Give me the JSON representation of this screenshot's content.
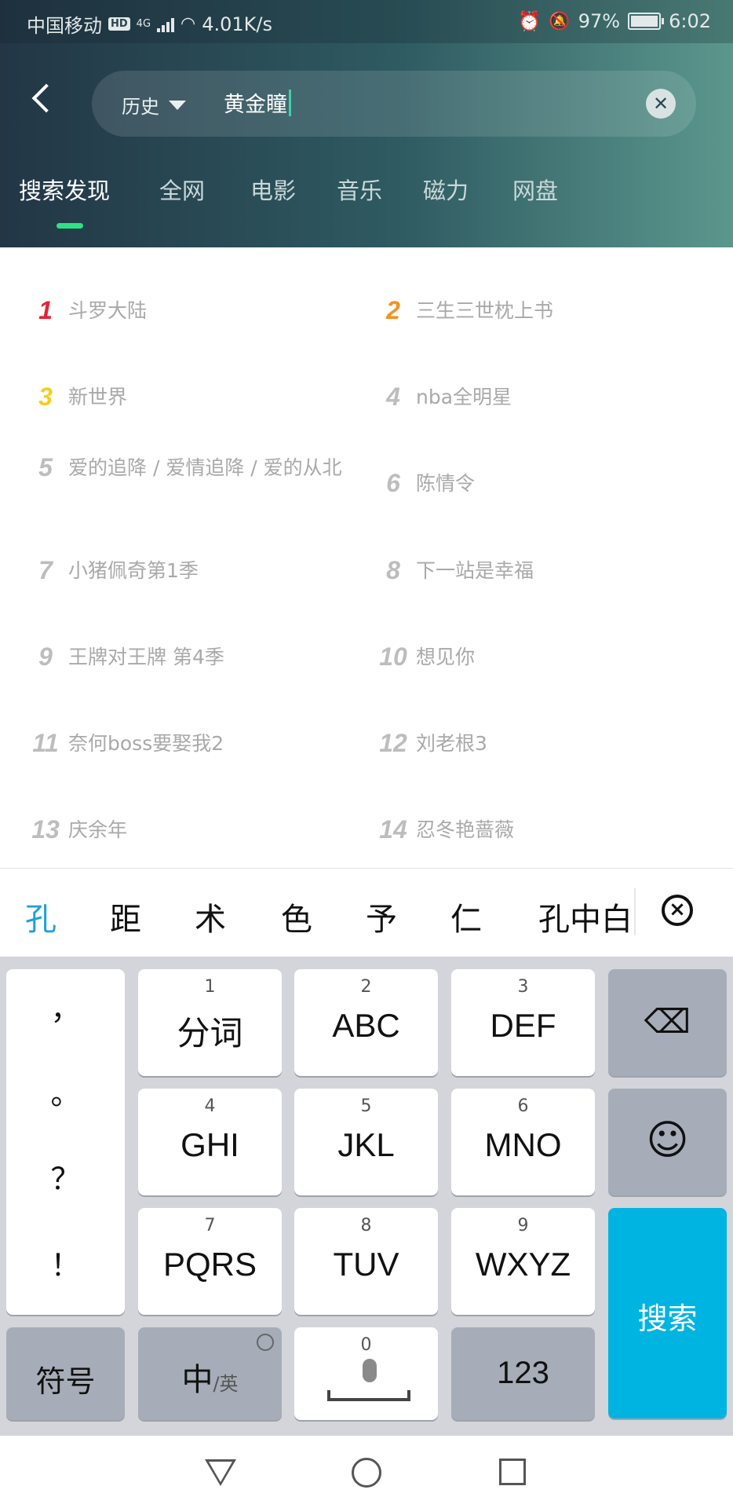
{
  "status_bar": {
    "carrier": "中国移动",
    "hd": "HD",
    "network": "4G",
    "speed": "4.01K/s",
    "battery": "97%",
    "time": "6:02",
    "icons": [
      "wifi-icon",
      "signal-icon",
      "alarm-icon",
      "mute-icon",
      "battery-icon"
    ]
  },
  "search": {
    "history_label": "历史",
    "query": "黄金瞳"
  },
  "tabs": [
    "搜索发现",
    "全网",
    "电影",
    "音乐",
    "磁力",
    "网盘"
  ],
  "active_tab": "搜索发现",
  "hot_list": [
    {
      "rank": "1",
      "title": "斗罗大陆"
    },
    {
      "rank": "2",
      "title": "三生三世枕上书"
    },
    {
      "rank": "3",
      "title": "新世界"
    },
    {
      "rank": "4",
      "title": "nba全明星"
    },
    {
      "rank": "5",
      "title": "爱的追降 / 爱情追降 / 爱的从北"
    },
    {
      "rank": "6",
      "title": "陈情令"
    },
    {
      "rank": "7",
      "title": "小猪佩奇第1季"
    },
    {
      "rank": "8",
      "title": "下一站是幸福"
    },
    {
      "rank": "9",
      "title": "王牌对王牌 第4季"
    },
    {
      "rank": "10",
      "title": "想见你"
    },
    {
      "rank": "11",
      "title": "奈何boss要娶我2"
    },
    {
      "rank": "12",
      "title": "刘老根3"
    },
    {
      "rank": "13",
      "title": "庆余年"
    },
    {
      "rank": "14",
      "title": "忍冬艳蔷薇"
    }
  ],
  "rank_colors": {
    "1": "#e8213a",
    "2": "#f39321",
    "3": "#f4cf1f",
    "default": "#bdbdbd"
  },
  "candidates": [
    "孔",
    "距",
    "术",
    "色",
    "予",
    "仁",
    "孔中白"
  ],
  "keyboard": {
    "punct": [
      "，",
      "。",
      "？",
      "！"
    ],
    "keys": [
      {
        "num": "1",
        "label": "分词"
      },
      {
        "num": "2",
        "label": "ABC"
      },
      {
        "num": "3",
        "label": "DEF"
      },
      {
        "num": "4",
        "label": "GHI"
      },
      {
        "num": "5",
        "label": "JKL"
      },
      {
        "num": "6",
        "label": "MNO"
      },
      {
        "num": "7",
        "label": "PQRS"
      },
      {
        "num": "8",
        "label": "TUV"
      },
      {
        "num": "9",
        "label": "WXYZ"
      }
    ],
    "symbols": "符号",
    "lang_main": "中",
    "lang_alt": "/英",
    "space_num": "0",
    "num_key": "123",
    "search_key": "搜索"
  },
  "accent": "#2ee283",
  "key_blue": "#00b4e1"
}
